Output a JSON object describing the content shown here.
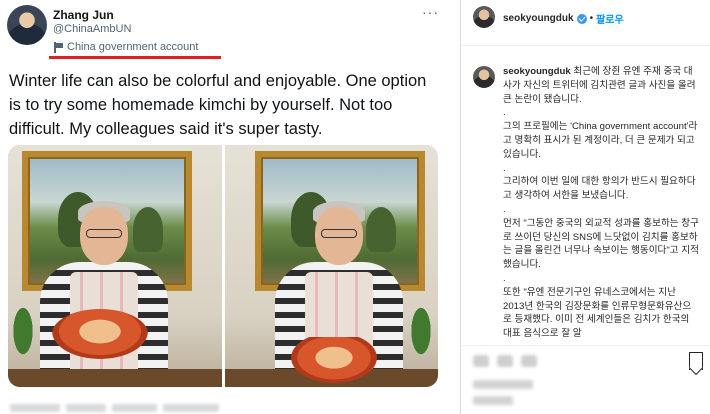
{
  "tweet": {
    "name": "Zhang Jun",
    "handle": "@ChinaAmbUN",
    "label": "China government account",
    "more": "···",
    "text": "Winter life can also be colorful and enjoyable. One option is to try some homemade kimchi by yourself. Not too difficult. My colleagues said it's super tasty."
  },
  "instagram": {
    "header_username": "seokyoungduk",
    "separator": "•",
    "follow": "팔로우",
    "caption_username": "seokyoungduk",
    "lines": [
      "최근에 장쥔 유엔 주재 중국 대사가 자신의 트위터에 김치관련 글과 사진을 올려 큰 논란이 됐습니다.",
      ".",
      "그의 프로필에는 'China government account'라고 명확히 표시가 된 계정이라, 더 큰 문제가 되고 있습니다.",
      ".",
      "그리하여 이번 일에 대한 항의가 반드시 필요하다고 생각하여 서한을 보냈습니다.",
      ".",
      "먼저 \"그동안 중국의 외교적 성과를 홍보하는 창구로 쓰이던 당신의 SNS에 느닷없이 김치를 홍보하는 글을 올린건 너무나 속보이는 행동이다\"고 지적했습니다.",
      ".",
      "또한 \"유엔 전문기구인 유네스코에서는 지난 2013년 한국의 김장문화를 인류무형문화유산으로 등재했다. 이미 전 세계인들은 김치가 한국의 대표 음식으로 잘 알"
    ]
  },
  "colors": {
    "accent_red": "#e02020",
    "twitter_gray": "#536471",
    "ig_blue": "#0095f6",
    "verified_blue": "#3897f0"
  }
}
